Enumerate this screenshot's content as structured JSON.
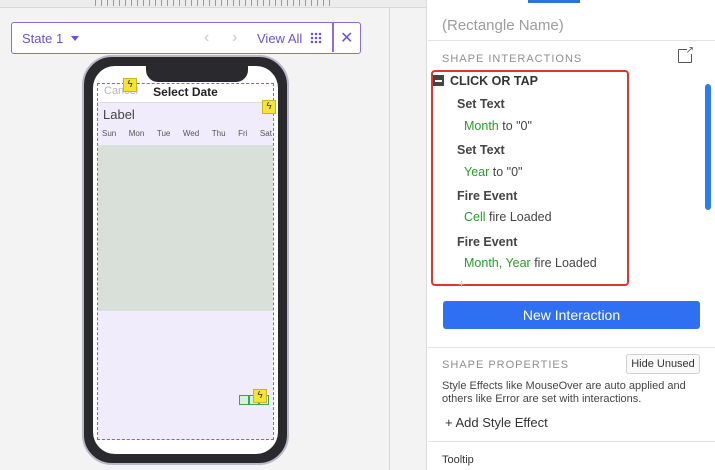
{
  "states": {
    "current": "State 1",
    "view_all": "View All"
  },
  "phone": {
    "cancel": "Cancel",
    "title": "Select Date",
    "label": "Label",
    "days": [
      "Sun",
      "Mon",
      "Tue",
      "Wed",
      "Thu",
      "Fri",
      "Sat"
    ]
  },
  "panel": {
    "rect_name_placeholder": "(Rectangle Name)",
    "shape_interactions_title": "SHAPE INTERACTIONS",
    "event": "CLICK OR TAP",
    "actions": [
      {
        "title": "Set Text",
        "target": "Month",
        "detail": " to \"0\""
      },
      {
        "title": "Set Text",
        "target": "Year",
        "detail": " to \"0\""
      },
      {
        "title": "Fire Event",
        "target": "Cell",
        "detail": " fire Loaded"
      },
      {
        "title": "Fire Event",
        "target": "Month, Year",
        "detail": " fire Loaded"
      }
    ],
    "new_interaction": "New Interaction",
    "shape_properties_title": "SHAPE PROPERTIES",
    "hide_unused": "Hide Unused",
    "help_text": "Style Effects like MouseOver are auto applied and others like Error are set with interactions.",
    "add_style_effect": "Add Style Effect",
    "tooltip": "Tooltip"
  },
  "colors": {
    "accent_purple": "#6c52d8",
    "primary_blue": "#2f6ff2",
    "highlight_red": "#e0352b",
    "target_green": "#2a9a2a"
  }
}
